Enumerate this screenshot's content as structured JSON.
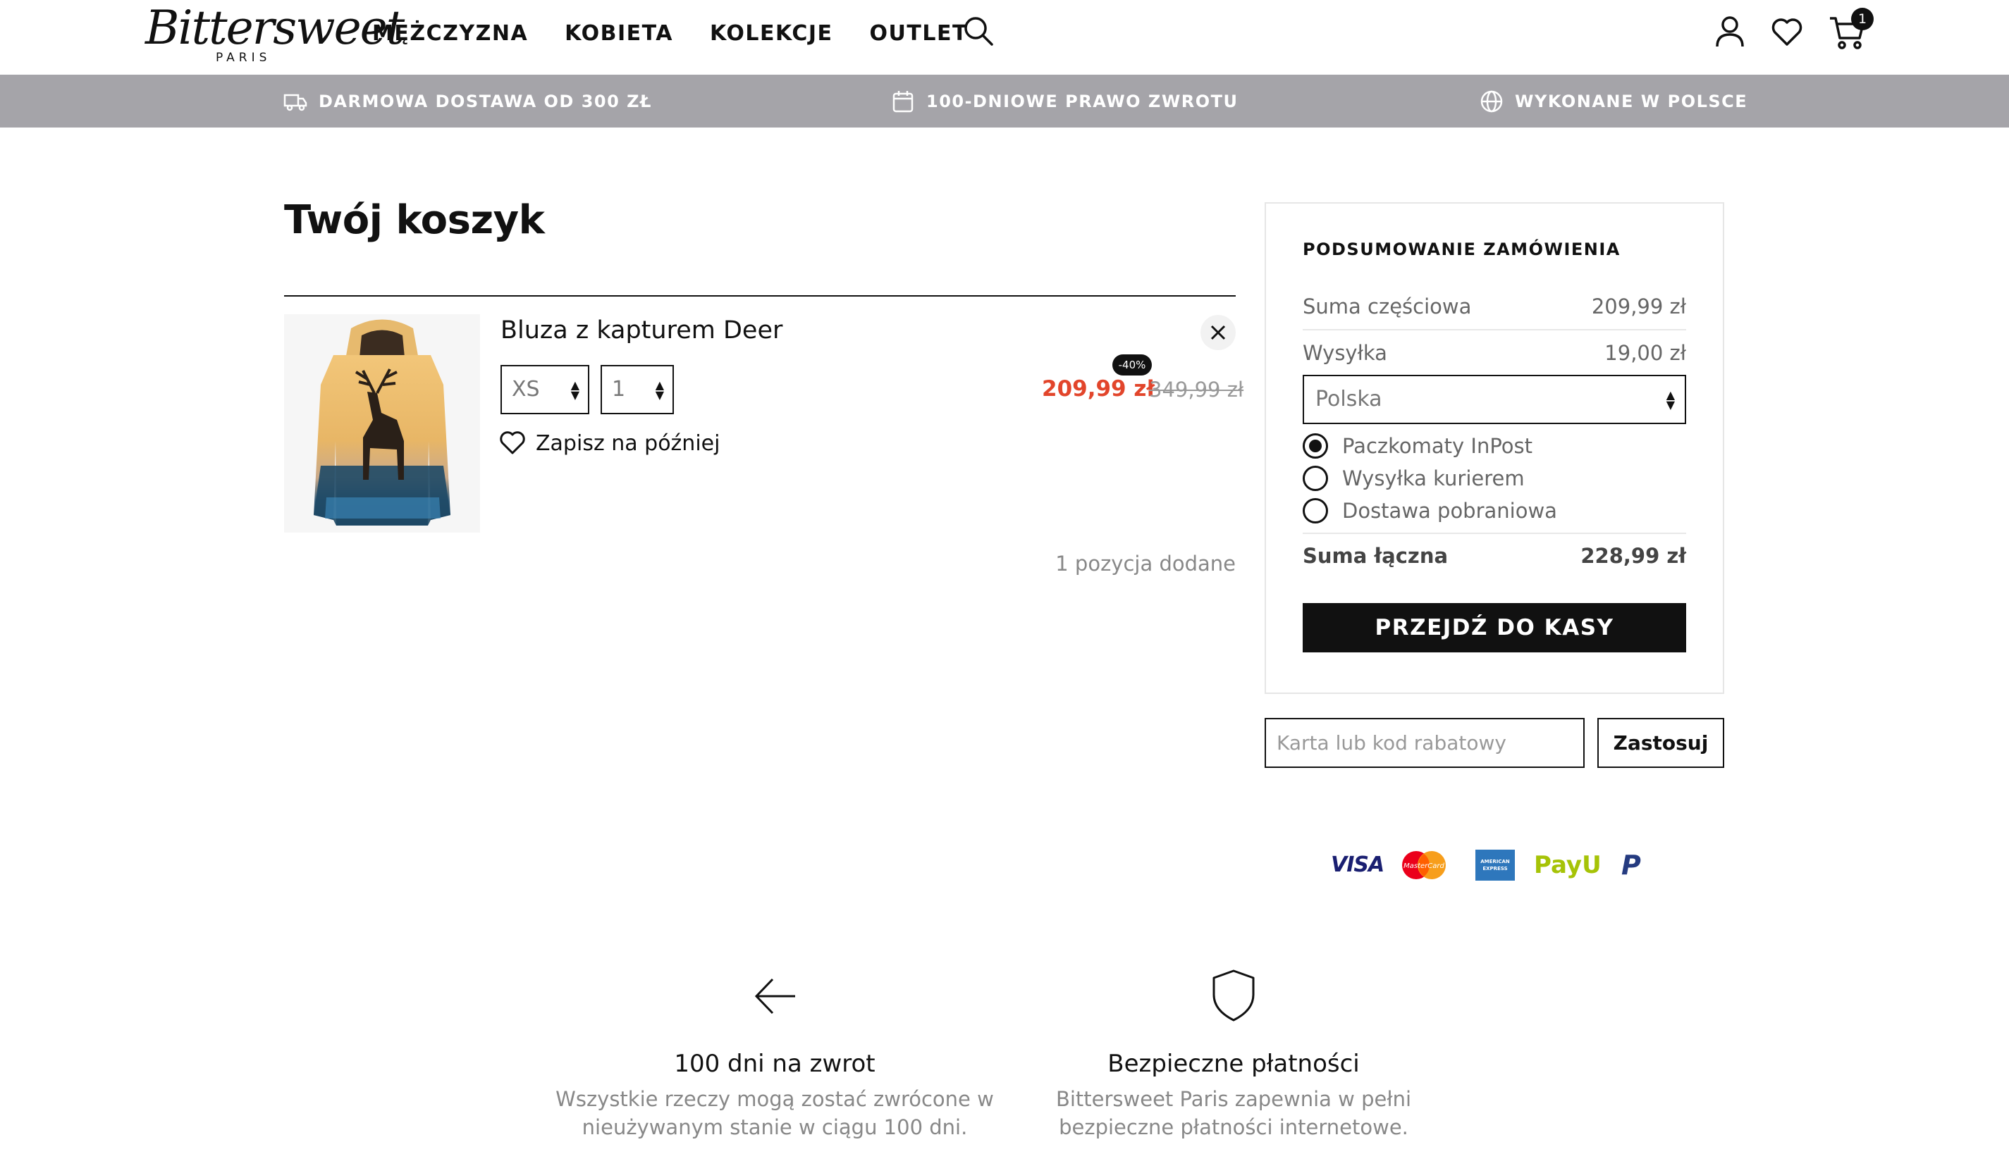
{
  "header": {
    "logo_script": "Bittersweet",
    "logo_sub": "PARIS",
    "nav": [
      "MĘŻCZYZNA",
      "KOBIETA",
      "KOLEKCJE",
      "OUTLET"
    ],
    "cart_count": "1"
  },
  "benefits": [
    {
      "label": "DARMOWA DOSTAWA OD 300 ZŁ",
      "icon": "truck-icon"
    },
    {
      "label": "100-DNIOWE PRAWO ZWROTU",
      "icon": "calendar-icon"
    },
    {
      "label": "WYKONANE W POLSCE",
      "icon": "globe-icon"
    }
  ],
  "cart": {
    "title": "Twój koszyk",
    "item": {
      "name": "Bluza z kapturem Deer",
      "size": "XS",
      "qty": "1",
      "save_label": "Zapisz na później",
      "discount": "-40%",
      "price": "209,99 zł",
      "old_price": "349,99 zł"
    },
    "count_text": "1 pozycja dodane"
  },
  "summary": {
    "title": "PODSUMOWANIE ZAMÓWIENIA",
    "subtotal_label": "Suma częściowa",
    "subtotal_value": "209,99 zł",
    "shipping_label": "Wysyłka",
    "shipping_value": "19,00 zł",
    "country": "Polska",
    "shipping_options": [
      {
        "label": "Paczkomaty InPost",
        "selected": true
      },
      {
        "label": "Wysyłka kurierem",
        "selected": false
      },
      {
        "label": "Dostawa pobraniowa",
        "selected": false
      }
    ],
    "total_label": "Suma łączna",
    "total_value": "228,99 zł",
    "checkout_label": "PRZEJDŹ DO KASY"
  },
  "coupon": {
    "placeholder": "Karta lub kod rabatowy",
    "apply_label": "Zastosuj"
  },
  "payments": {
    "visa": "VISA",
    "mastercard": "MasterCard",
    "amex": "AMERICAN EXPRESS",
    "payu": "PayU",
    "paypal": "P"
  },
  "features": [
    {
      "title": "100 dni na zwrot",
      "desc_line1": "Wszystkie rzeczy mogą zostać zwrócone w",
      "desc_line2": "nieużywanym stanie w ciągu 100 dni.",
      "icon": "arrow-left-icon"
    },
    {
      "title": "Bezpieczne płatności",
      "desc_line1": "Bittersweet Paris zapewnia w pełni",
      "desc_line2": "bezpieczne płatności internetowe.",
      "icon": "shield-icon"
    }
  ],
  "colors": {
    "benefits_bar": "#a5a4a9",
    "sale_price": "#e2452b",
    "button": "#111111"
  }
}
